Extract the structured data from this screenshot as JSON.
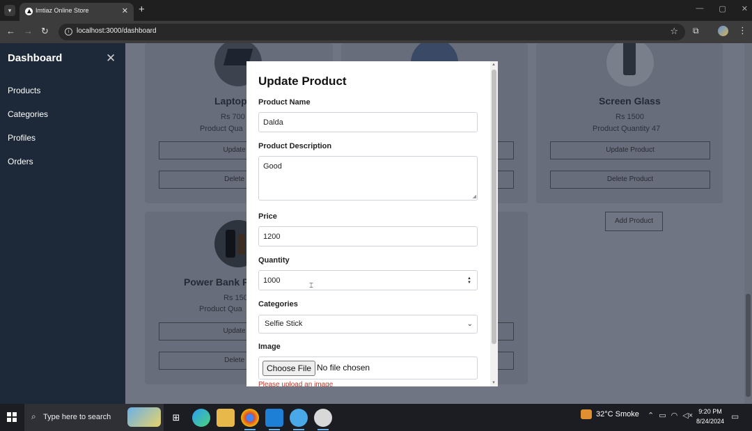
{
  "browser": {
    "tab_title": "Imtiaz Online Store",
    "url": "localhost:3000/dashboard",
    "tab_close": "✕",
    "new_tab": "+",
    "window_controls": [
      "—",
      "▢",
      "✕"
    ]
  },
  "sidebar": {
    "title": "Dashboard",
    "close": "✕",
    "items": [
      {
        "label": "Products"
      },
      {
        "label": "Categories"
      },
      {
        "label": "Profiles"
      },
      {
        "label": "Orders"
      }
    ]
  },
  "cards": [
    {
      "title": "Laptop",
      "price": "Rs 700",
      "quantity": "Product Qua",
      "update_label": "Update Pr",
      "delete_label": "Delete Pr"
    },
    {
      "title": "",
      "price": "",
      "quantity": "",
      "update_label": "",
      "delete_label": ""
    },
    {
      "title": "Screen Glass",
      "price": "Rs 1500",
      "quantity": "Product Quantity 47",
      "update_label": "Update Product",
      "delete_label": "Delete Product"
    },
    {
      "title": "Power Bank F",
      "price": "Rs 150",
      "quantity": "Product Qua",
      "update_label": "Update Pr",
      "delete_label": "Delete Pr"
    },
    {
      "title": "",
      "price": "",
      "quantity": "",
      "update_label": "",
      "delete_label": ""
    }
  ],
  "add_product_label": "Add Product",
  "modal": {
    "title": "Update Product",
    "name_label": "Product Name",
    "name_value": "Dalda",
    "description_label": "Product Description",
    "description_value": "Good",
    "price_label": "Price",
    "price_value": "1200",
    "quantity_label": "Quantity",
    "quantity_value": "1000",
    "categories_label": "Categories",
    "category_selected": "Selfie Stick",
    "image_label": "Image",
    "file_button": "Choose File",
    "file_status": "No file chosen",
    "error": "Please upload an image"
  },
  "taskbar": {
    "search_placeholder": "Type here to search",
    "weather": "32°C  Smoke",
    "time": "9:20 PM",
    "date": "8/24/2024"
  },
  "colors": {
    "sidebar_bg": "#1d2939",
    "overlay_bg": "#6f7582",
    "error": "#c0392b"
  }
}
